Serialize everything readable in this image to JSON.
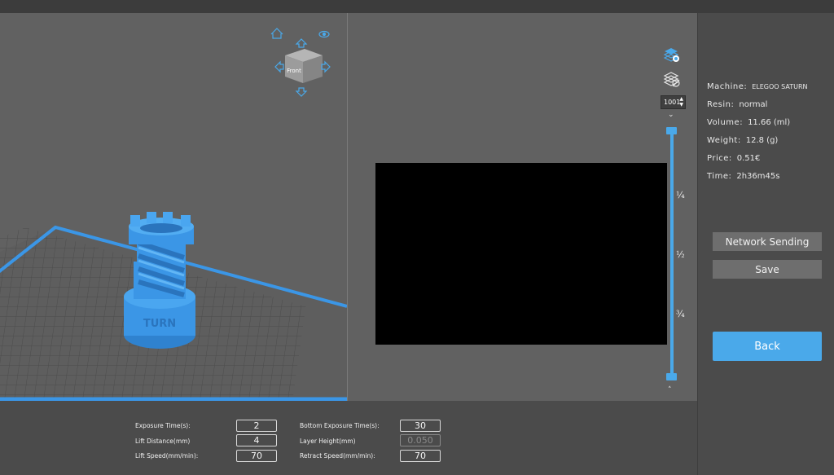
{
  "viewcube": {
    "front_label": "Front"
  },
  "slice_view": {
    "layer_number": "1001",
    "fractions": [
      "¼",
      "½",
      "¾"
    ],
    "layer_progress": 0.0
  },
  "info": {
    "machine_label": "Machine:",
    "machine_value": "ELEGOO SATURN",
    "resin_label": "Resin:",
    "resin_value": "normal",
    "volume_label": "Volume:",
    "volume_value": "11.66  (ml)",
    "weight_label": "Weight:",
    "weight_value": "12.8  (g)",
    "price_label": "Price:",
    "price_value": "0.51€",
    "time_label": "Time:",
    "time_value": "2h36m45s"
  },
  "buttons": {
    "network_sending": "Network Sending",
    "save": "Save",
    "back": "Back"
  },
  "params": {
    "exposure_time_label": "Exposure Time(s):",
    "exposure_time_value": "2",
    "lift_distance_label": "Lift Distance(mm)",
    "lift_distance_value": "4",
    "lift_speed_label": "Lift Speed(mm/min):",
    "lift_speed_value": "70",
    "bottom_exposure_label": "Bottom Exposure Time(s):",
    "bottom_exposure_value": "30",
    "layer_height_label": "Layer Height(mm)",
    "layer_height_value": "0.050",
    "retract_speed_label": "Retract Speed(mm/min):",
    "retract_speed_value": "70"
  },
  "colors": {
    "accent": "#4aa9ea",
    "model": "#3b96e6",
    "preview_bg": "#000000"
  }
}
